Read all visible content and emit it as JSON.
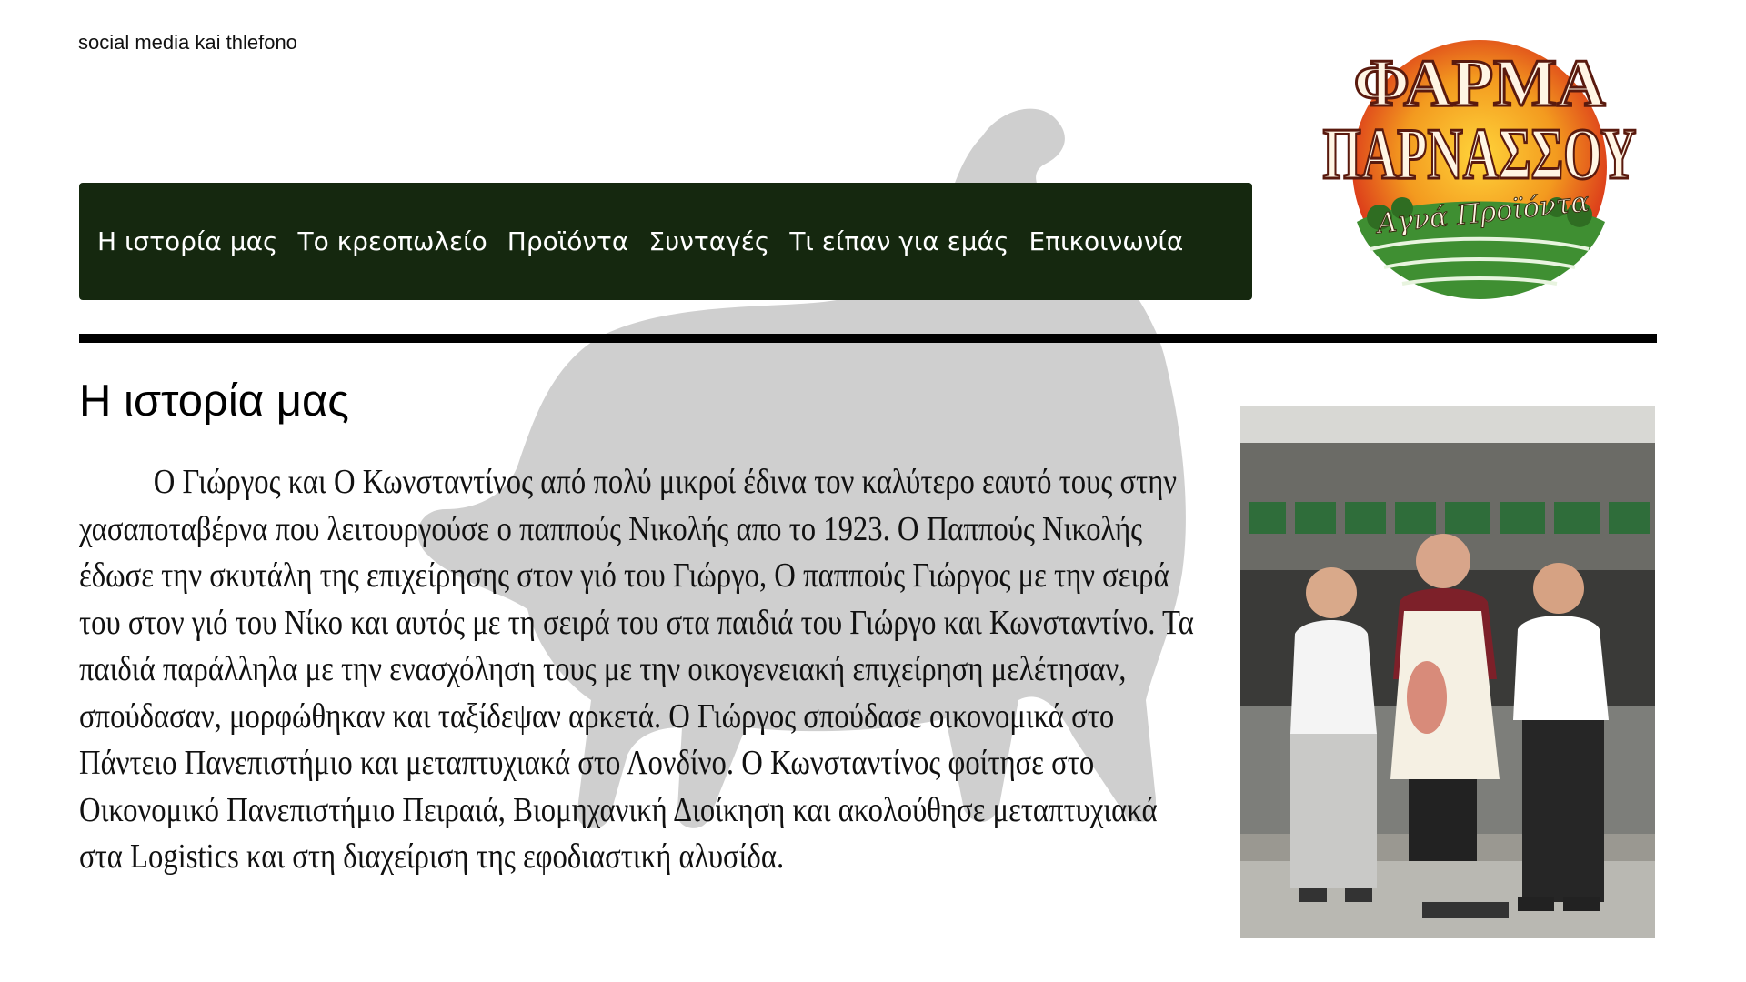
{
  "header": {
    "social_text": "social media kai thlefono"
  },
  "logo": {
    "line1": "ΦΑΡΜΑ",
    "line2": "ΠΑΡΝΑΣΣΟΥ",
    "tagline": "Αγνά Προϊόντα",
    "colors": {
      "orange": "#f39a1f",
      "red": "#d9301a",
      "green": "#2f7d2c",
      "cream": "#fff5e4"
    }
  },
  "nav": {
    "items": [
      {
        "label": "Η ιστορία μας"
      },
      {
        "label": "Το κρεοπωλείο"
      },
      {
        "label": "Προϊόντα"
      },
      {
        "label": "Συνταγές"
      },
      {
        "label": "Τι είπαν για εμάς"
      },
      {
        "label": "Επικοινωνία"
      }
    ],
    "background": "#15280f"
  },
  "main": {
    "title": "Η ιστορία μας",
    "story": "Ο Γιώργος και Ο Κωνσταντίνος από πολύ μικροί έδινα τον καλύτερο εαυτό τους στην χασαποταβέρνα που λειτουργούσε ο παππούς Νικολής απο το 1923. Ο Παππούς Νικολής έδωσε την σκυτάλη της επιχείρησης στον γιό του Γιώργο, Ο παππούς Γιώργος με την σειρά του στον γιό του Νίκο και αυτός με τη σειρά του στα παιδιά του Γιώργο και Κωνσταντίνο. Τα παιδιά παράλληλα με την ενασχόληση τους με την οικογενειακή επιχείρηση μελέτησαν, σπούδασαν, μορφώθηκαν και ταξίδεψαν αρκετά. Ο Γιώργος σπούδασε οικονομικά στο Πάντειο Πανεπιστήμιο και μεταπτυχιακά στο Λονδίνο. Ο Κωνσταντίνος φοίτησε στο Οικονομικό Πανεπιστήμιο Πειραιά, Βιομηχανική Διοίκηση και ακολούθησε μεταπτυχιακά στα Logistics και στη διαχείριση της εφοδιαστική αλυσίδα."
  },
  "watermark_color": "#cfcfcf"
}
